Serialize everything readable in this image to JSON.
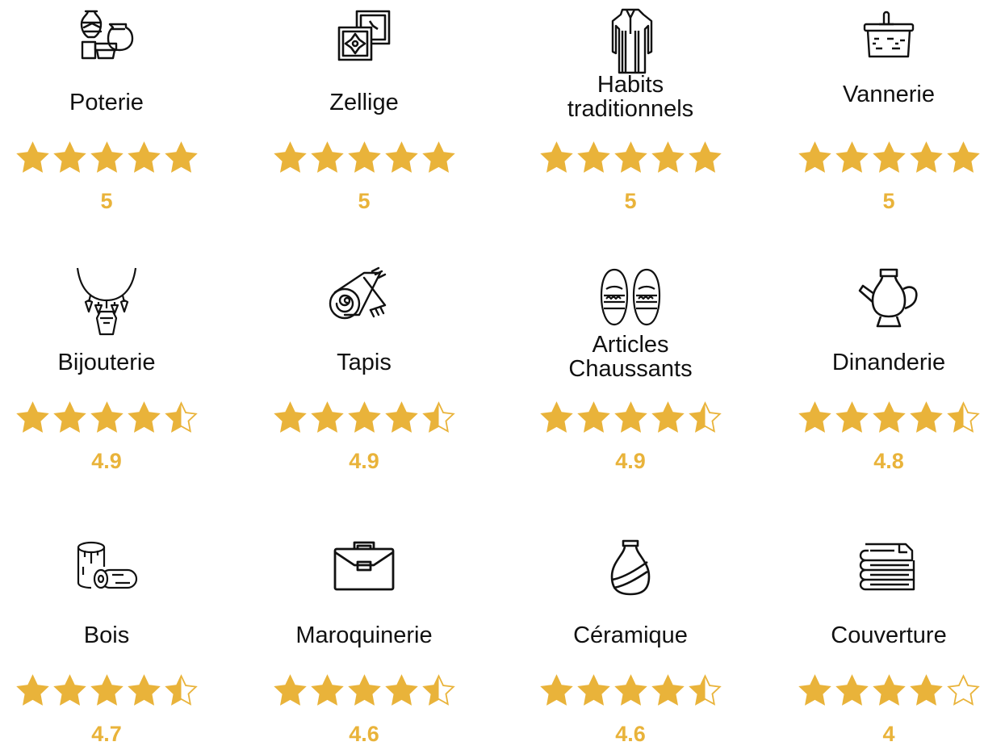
{
  "accent_color": "#e9b33a",
  "items": [
    {
      "label": "Poterie",
      "score": "5",
      "rating": 5,
      "icon": "pottery-icon"
    },
    {
      "label": "Zellige",
      "score": "5",
      "rating": 5,
      "icon": "zellige-tile-icon"
    },
    {
      "label": "Habits traditionnels",
      "score": "5",
      "rating": 5,
      "icon": "traditional-robe-icon"
    },
    {
      "label": "Vannerie",
      "score": "5",
      "rating": 5,
      "icon": "basket-icon"
    },
    {
      "label": "Bijouterie",
      "score": "4.9",
      "rating": 4.9,
      "icon": "necklace-icon"
    },
    {
      "label": "Tapis",
      "score": "4.9",
      "rating": 4.9,
      "icon": "rolled-carpet-icon"
    },
    {
      "label": "Articles Chaussants",
      "score": "4.9",
      "rating": 4.9,
      "icon": "babouche-slippers-icon"
    },
    {
      "label": "Dinanderie",
      "score": "4.8",
      "rating": 4.8,
      "icon": "teapot-ewer-icon"
    },
    {
      "label": "Bois",
      "score": "4.7",
      "rating": 4.7,
      "icon": "wood-logs-icon"
    },
    {
      "label": "Maroquinerie",
      "score": "4.6",
      "rating": 4.6,
      "icon": "briefcase-icon"
    },
    {
      "label": "Céramique",
      "score": "4.6",
      "rating": 4.6,
      "icon": "vase-icon"
    },
    {
      "label": "Couverture",
      "score": "4",
      "rating": 4,
      "icon": "folded-blankets-icon"
    }
  ]
}
